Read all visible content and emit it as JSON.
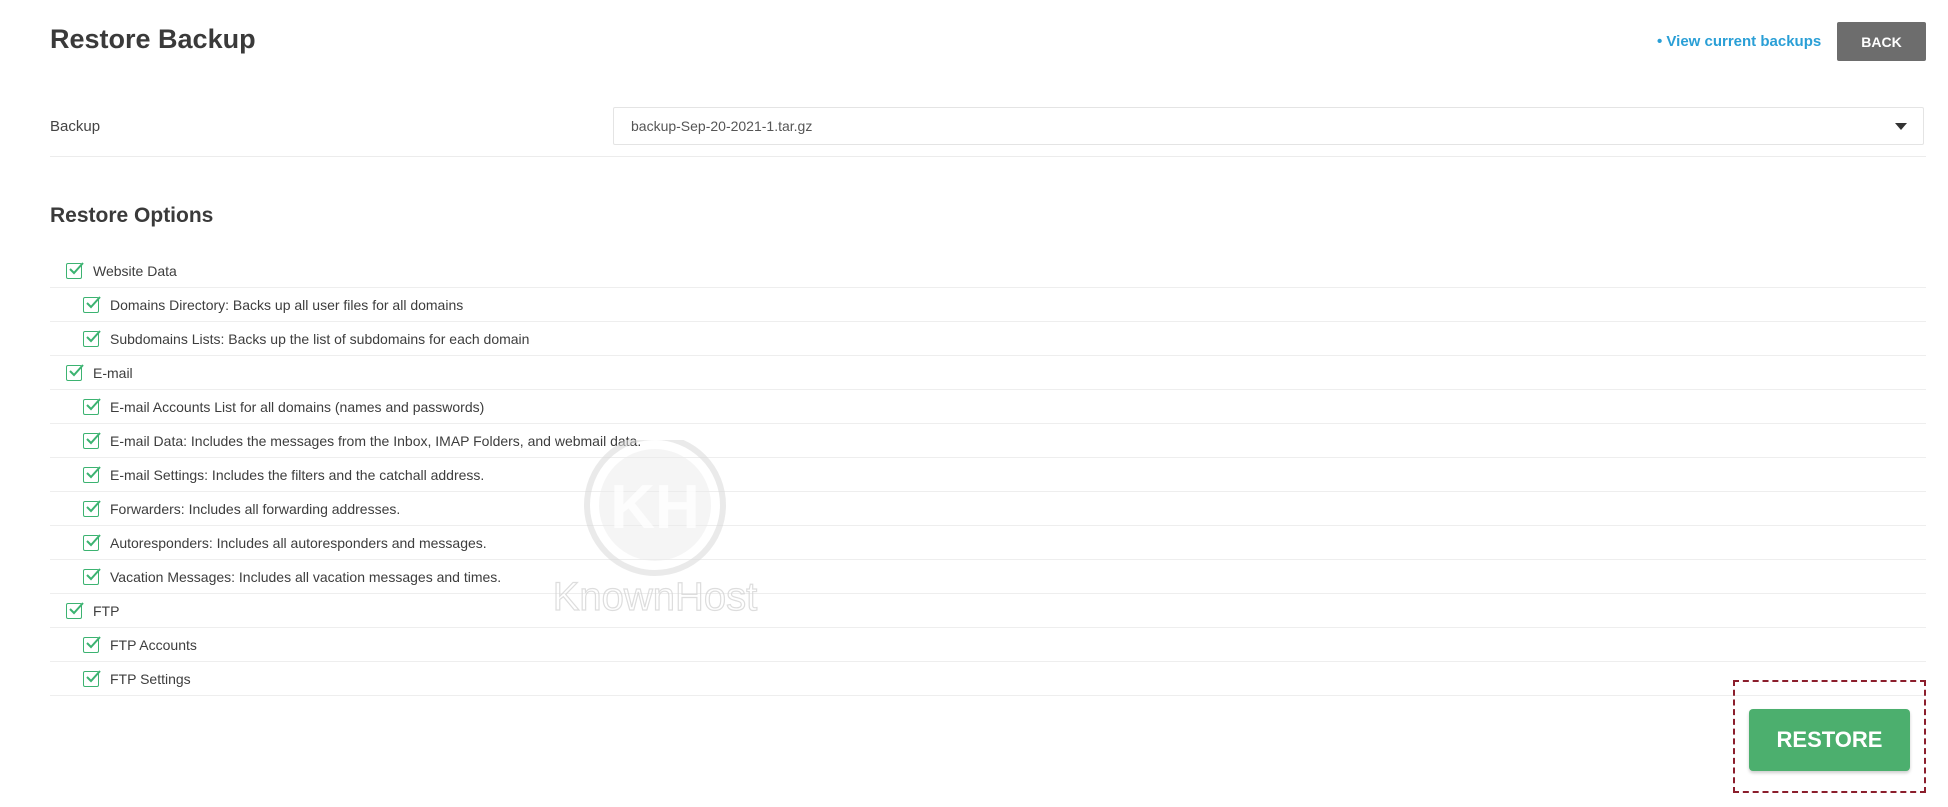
{
  "header": {
    "title": "Restore Backup",
    "view_link": "• View current backups",
    "back_label": "BACK"
  },
  "backup": {
    "label": "Backup",
    "selected": "backup-Sep-20-2021-1.tar.gz"
  },
  "restore_options": {
    "title": "Restore Options",
    "items": [
      {
        "label": "Website Data",
        "level": 0,
        "checked": true
      },
      {
        "label": "Domains Directory: Backs up all user files for all domains",
        "level": 1,
        "checked": true
      },
      {
        "label": "Subdomains Lists: Backs up the list of subdomains for each domain",
        "level": 1,
        "checked": true
      },
      {
        "label": "E-mail",
        "level": 0,
        "checked": true
      },
      {
        "label": "E-mail Accounts List for all domains (names and passwords)",
        "level": 1,
        "checked": true
      },
      {
        "label": "E-mail Data: Includes the messages from the Inbox, IMAP Folders, and webmail data.",
        "level": 1,
        "checked": true
      },
      {
        "label": "E-mail Settings: Includes the filters and the catchall address.",
        "level": 1,
        "checked": true
      },
      {
        "label": "Forwarders: Includes all forwarding addresses.",
        "level": 1,
        "checked": true
      },
      {
        "label": "Autoresponders: Includes all autoresponders and messages.",
        "level": 1,
        "checked": true
      },
      {
        "label": "Vacation Messages: Includes all vacation messages and times.",
        "level": 1,
        "checked": true
      },
      {
        "label": "FTP",
        "level": 0,
        "checked": true
      },
      {
        "label": "FTP Accounts",
        "level": 1,
        "checked": true
      },
      {
        "label": "FTP Settings",
        "level": 1,
        "checked": true
      }
    ]
  },
  "restore_button": "RESTORE",
  "watermark": {
    "text": "KnownHost",
    "monogram": "KH"
  },
  "colors": {
    "accent_link": "#2a9fd6",
    "check_green": "#3cb371",
    "restore_green": "#4caf6e",
    "back_gray": "#6d6d6d",
    "highlight_frame": "#8b1e2c"
  }
}
